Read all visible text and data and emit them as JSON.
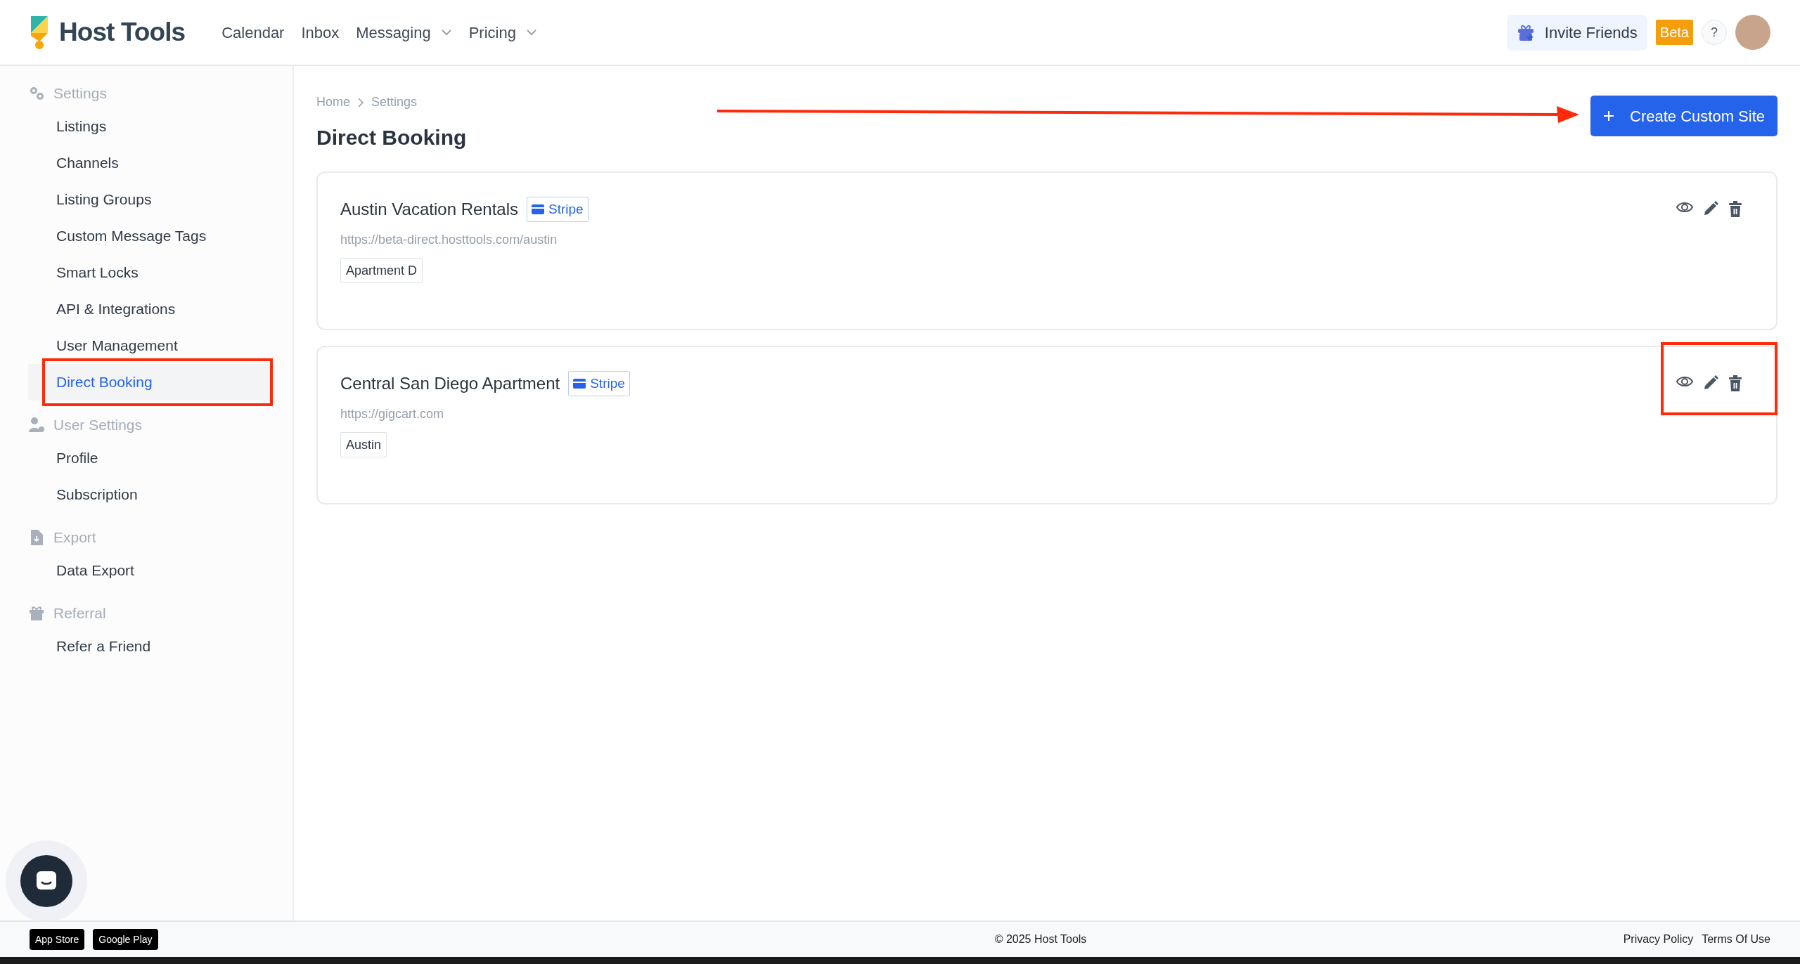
{
  "header": {
    "logo_text": "Host Tools",
    "nav": [
      {
        "label": "Calendar",
        "dropdown": false
      },
      {
        "label": "Inbox",
        "dropdown": false
      },
      {
        "label": "Messaging",
        "dropdown": true
      },
      {
        "label": "Pricing",
        "dropdown": true
      }
    ],
    "invite_button": "Invite Friends",
    "beta_badge": "Beta",
    "help_button": "?"
  },
  "sidebar": {
    "sections": [
      {
        "title": "Settings",
        "items": [
          {
            "label": "Listings",
            "selected": false
          },
          {
            "label": "Channels",
            "selected": false
          },
          {
            "label": "Listing Groups",
            "selected": false
          },
          {
            "label": "Custom Message Tags",
            "selected": false
          },
          {
            "label": "Smart Locks",
            "selected": false
          },
          {
            "label": "API & Integrations",
            "selected": false
          },
          {
            "label": "User Management",
            "selected": false
          },
          {
            "label": "Direct Booking",
            "selected": true
          }
        ]
      },
      {
        "title": "User Settings",
        "items": [
          {
            "label": "Profile",
            "selected": false
          },
          {
            "label": "Subscription",
            "selected": false
          }
        ]
      },
      {
        "title": "Export",
        "items": [
          {
            "label": "Data Export",
            "selected": false
          }
        ]
      },
      {
        "title": "Referral",
        "items": [
          {
            "label": "Refer a Friend",
            "selected": false
          }
        ]
      }
    ]
  },
  "breadcrumb": [
    "Home",
    "Settings"
  ],
  "page_title": "Direct Booking",
  "create_button": "Create Custom Site",
  "sites": [
    {
      "name": "Austin Vacation Rentals",
      "payment_badge": "Stripe",
      "url": "https://beta-direct.hosttools.com/austin",
      "tags": [
        "Apartment D"
      ]
    },
    {
      "name": "Central San Diego Apartment",
      "payment_badge": "Stripe",
      "url": "https://gigcart.com",
      "tags": [
        "Austin"
      ]
    }
  ],
  "footer": {
    "app_badges": [
      "App Store",
      "Google Play"
    ],
    "copyright": "© 2025 Host Tools",
    "links": [
      "Privacy Policy",
      "Terms Of Use"
    ]
  }
}
